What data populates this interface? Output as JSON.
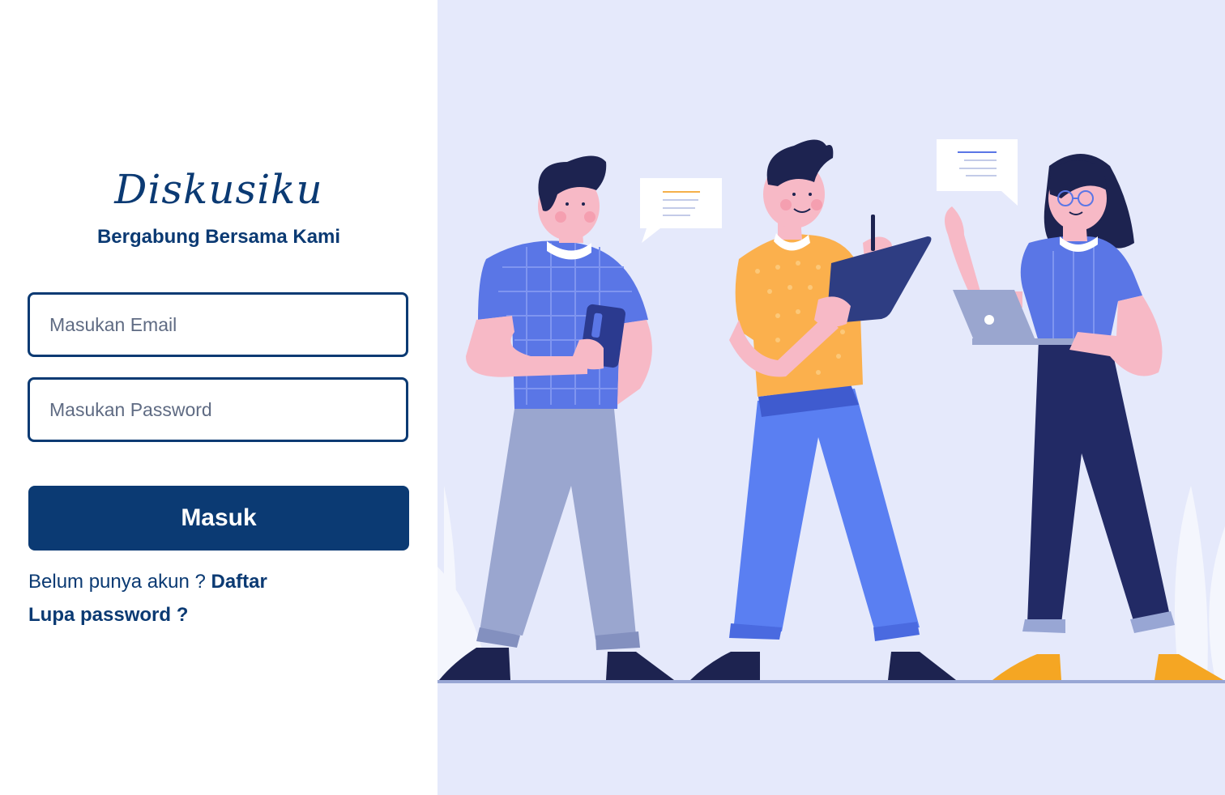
{
  "brand": {
    "name": "Diskusiku",
    "tagline": "Bergabung Bersama Kami"
  },
  "form": {
    "email_placeholder": "Masukan Email",
    "password_placeholder": "Masukan Password",
    "submit_label": "Masuk"
  },
  "links": {
    "signup_prompt": "Belum punya akun ? ",
    "signup_label": "Daftar",
    "forgot_label": "Lupa password ?"
  },
  "colors": {
    "primary": "#0b3a73",
    "illustration_bg": "#e5e9fb"
  },
  "illustration": {
    "icon": "people-collaborating-illustration"
  }
}
